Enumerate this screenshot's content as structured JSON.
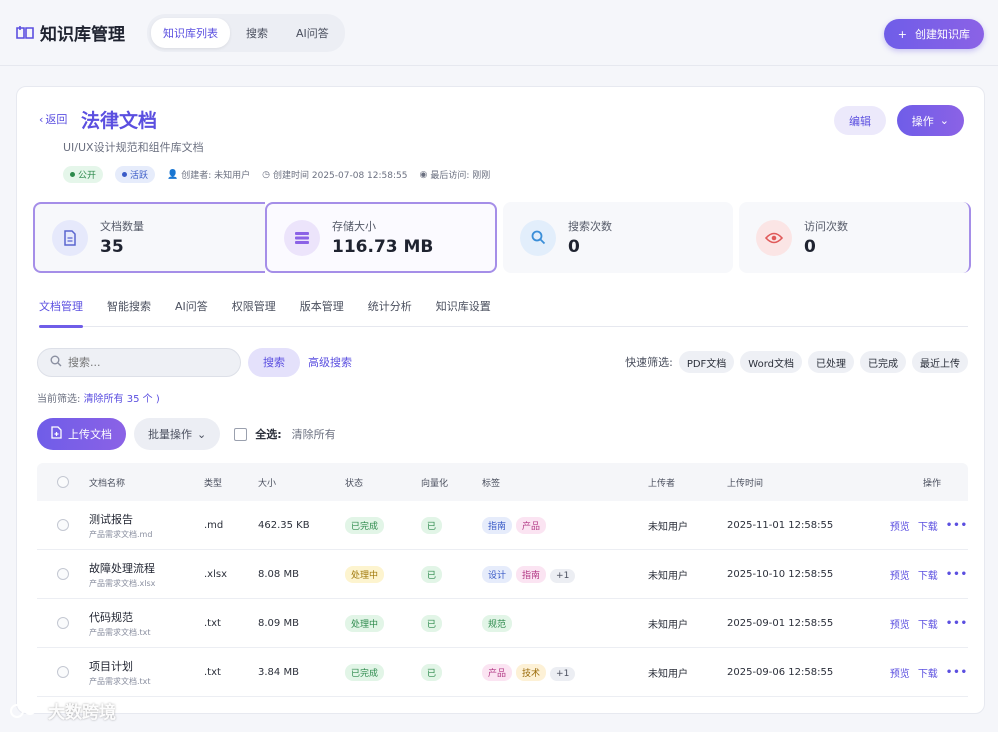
{
  "app": {
    "title": "知识库管理",
    "top_tabs": [
      "知识库列表",
      "搜索",
      "AI问答"
    ],
    "create_button": "创建知识库"
  },
  "kb": {
    "back": "返回",
    "title": "法律文档",
    "subtitle": "UI/UX设计规范和组件库文档",
    "badge_public": "公开",
    "badge_active": "活跃",
    "creator": "创建者: 未知用户",
    "created_time": "创建时间 2025-07-08 12:58:55",
    "last_visit": "最后访问: 刚刚",
    "edit_button": "编辑",
    "ops_button": "操作"
  },
  "stats": [
    {
      "label": "文档数量",
      "value": "35",
      "icon": "document-icon",
      "color": "#6f7fe0"
    },
    {
      "label": "存储大小",
      "value": "116.73 MB",
      "icon": "database-icon",
      "color": "#8b62e6"
    },
    {
      "label": "搜索次数",
      "value": "0",
      "icon": "search-icon",
      "color": "#3a8ed8"
    },
    {
      "label": "访问次数",
      "value": "0",
      "icon": "eye-icon",
      "color": "#e05a5a"
    }
  ],
  "tabs": [
    "文档管理",
    "智能搜索",
    "AI问答",
    "权限管理",
    "版本管理",
    "统计分析",
    "知识库设置"
  ],
  "search": {
    "placeholder": "搜索...",
    "button": "搜索",
    "advanced": "高级搜索",
    "quick_label": "快速筛选:",
    "quick_filters": [
      "PDF文档",
      "Word文档",
      "已处理",
      "已完成",
      "最近上传"
    ]
  },
  "filter": {
    "prefix": "当前筛选:",
    "link": "清除所有",
    "suffix": "35 个 )"
  },
  "actions": {
    "upload": "上传文档",
    "batch": "批量操作",
    "select_all": "全选:",
    "clear_all": "清除所有"
  },
  "table": {
    "headers": [
      "文档名称",
      "类型",
      "大小",
      "状态",
      "向量化",
      "标签",
      "上传者",
      "上传时间",
      "操作"
    ],
    "rows": [
      {
        "name": "测试报告",
        "desc": "产品需求文档.md",
        "type": ".md",
        "size": "462.35 KB",
        "status": "已完成",
        "vector": "已",
        "tags": [
          "指南",
          "产品"
        ],
        "uploader": "未知用户",
        "time": "2025-11-01 12:58:55"
      },
      {
        "name": "故障处理流程",
        "desc": "产品需求文档.xlsx",
        "type": ".xlsx",
        "size": "8.08 MB",
        "status": "处理中",
        "vector": "已",
        "tags": [
          "设计",
          "指南",
          "+1"
        ],
        "uploader": "未知用户",
        "time": "2025-10-10 12:58:55"
      },
      {
        "name": "代码规范",
        "desc": "产品需求文档.txt",
        "type": ".txt",
        "size": "8.09 MB",
        "status": "处理中",
        "vector": "已",
        "tags": [
          "规范"
        ],
        "uploader": "未知用户",
        "time": "2025-09-01 12:58:55"
      },
      {
        "name": "项目计划",
        "desc": "产品需求文档.txt",
        "type": ".txt",
        "size": "3.84 MB",
        "status": "已完成",
        "vector": "已",
        "tags": [
          "产品",
          "技术",
          "+1"
        ],
        "uploader": "未知用户",
        "time": "2025-09-06 12:58:55"
      }
    ],
    "op_preview": "预览",
    "op_download": "下载",
    "op_more": "•••"
  },
  "watermark": "大数跨境"
}
